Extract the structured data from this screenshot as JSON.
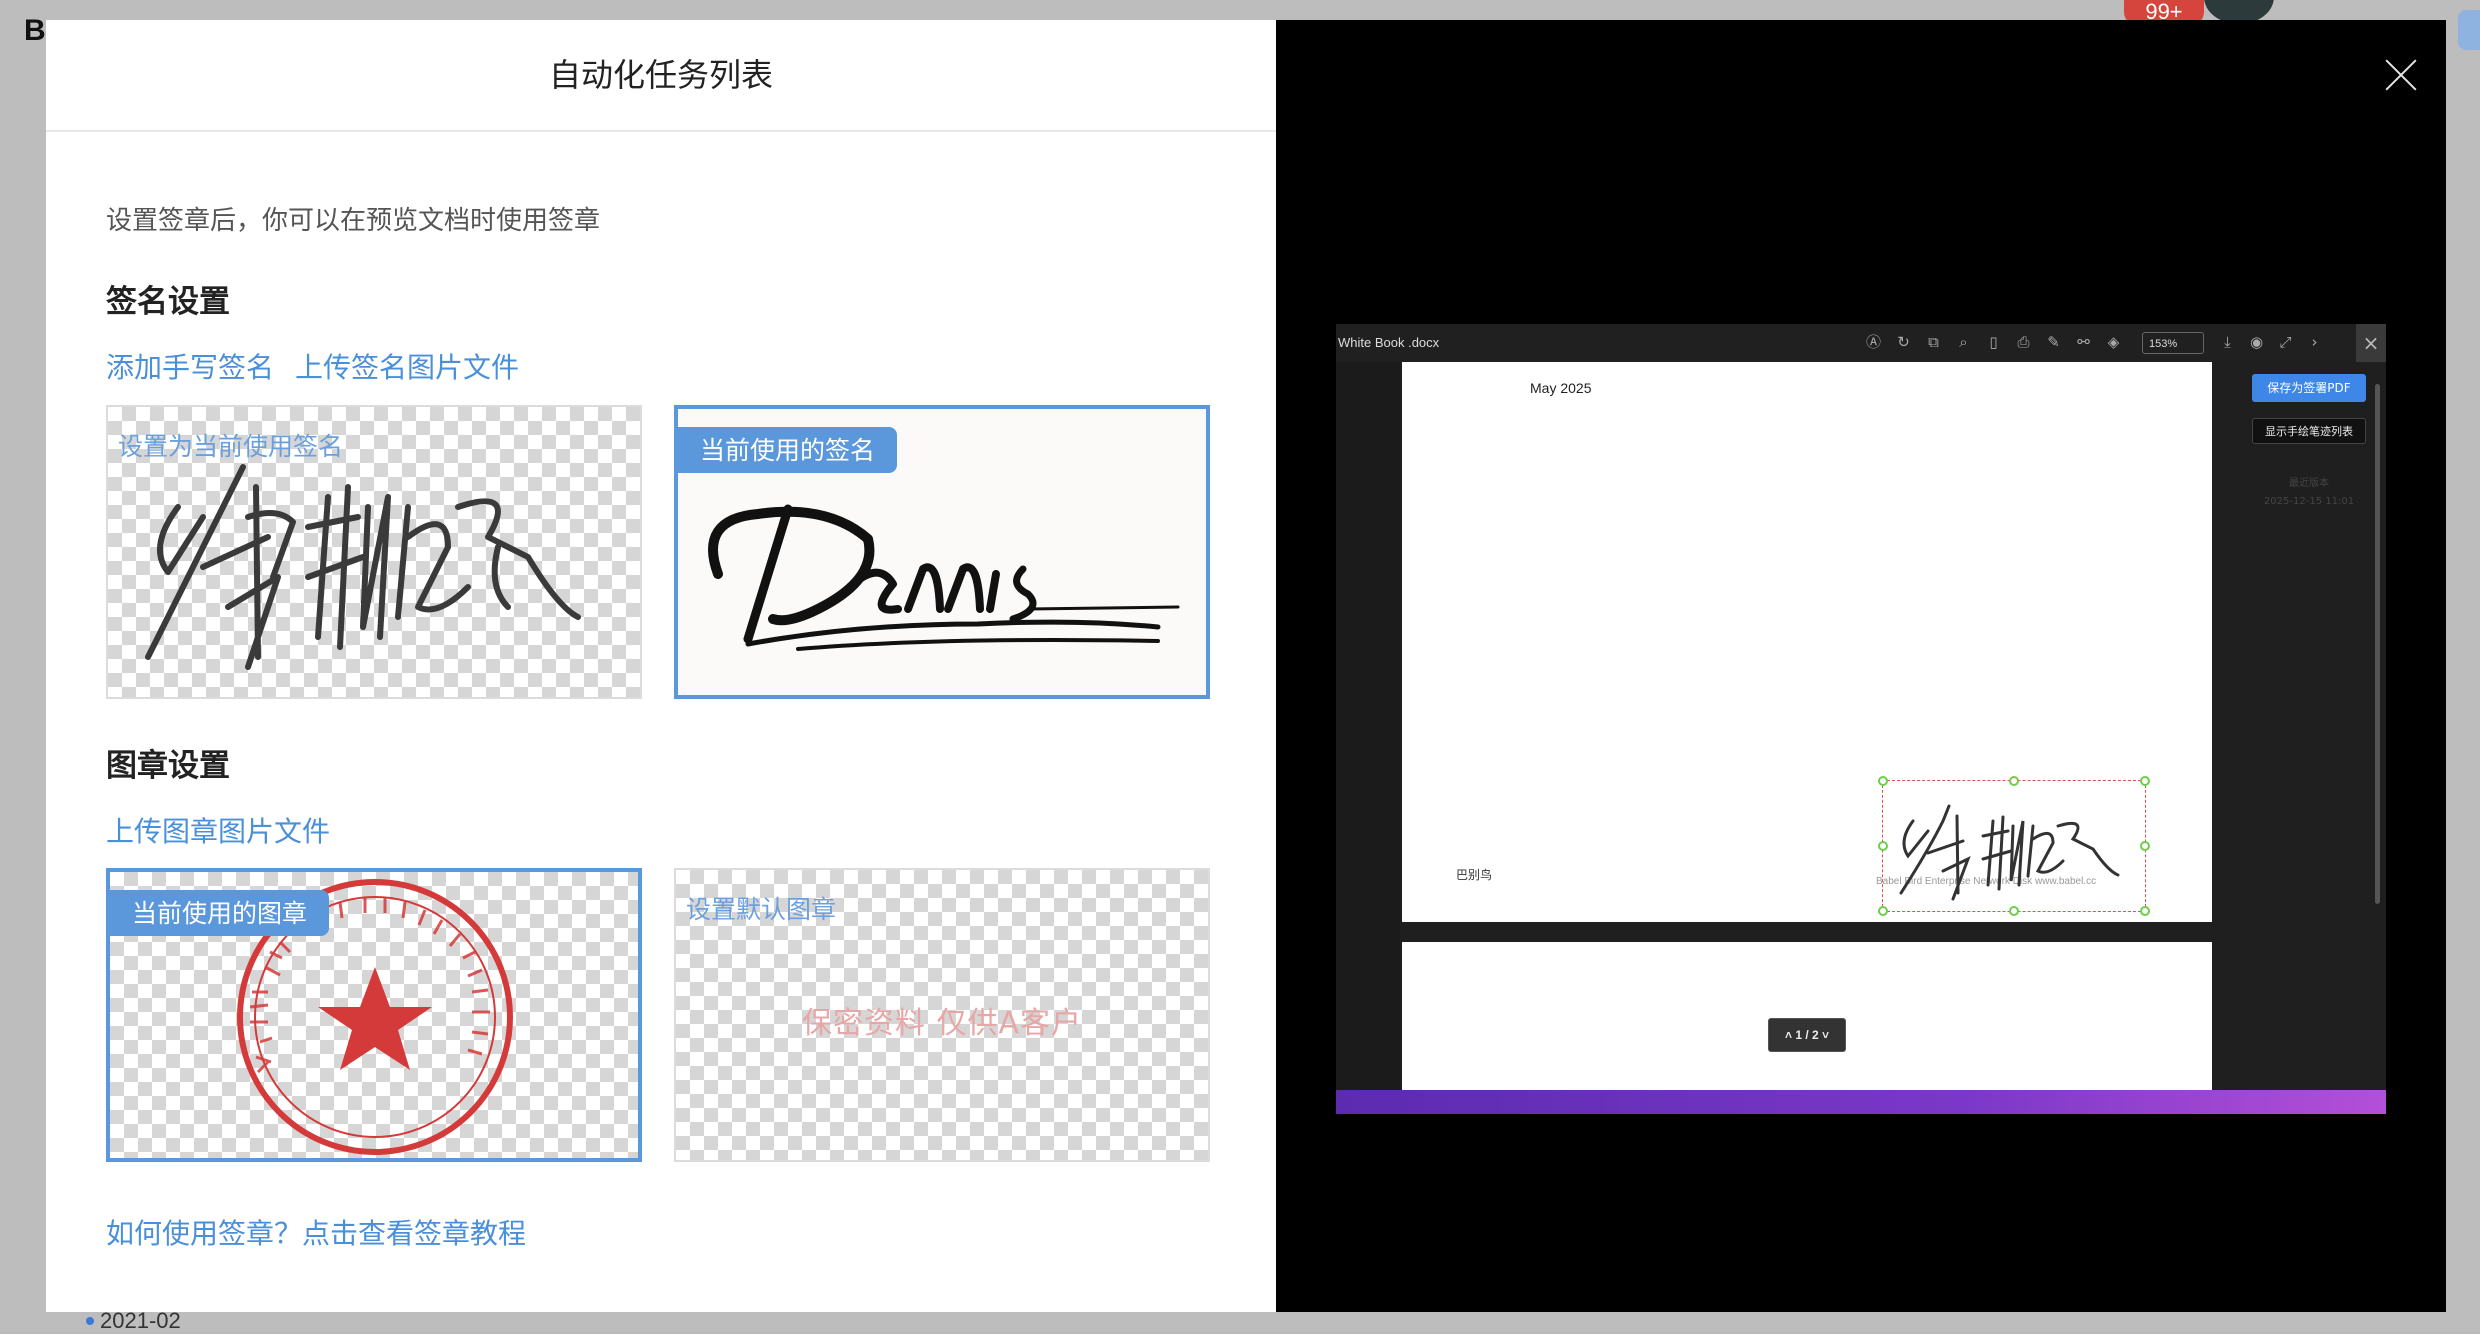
{
  "background": {
    "logo": "B",
    "badge": "99+",
    "date_item": "2021-02"
  },
  "modal": {
    "title": "自动化任务列表",
    "intro": "设置签章后，你可以在预览文档时使用签章",
    "signature_section": {
      "title": "签名设置",
      "add_handwritten": "添加手写签名",
      "upload_image": "上传签名图片文件",
      "cards": [
        {
          "hint": "设置为当前使用签名",
          "active": false
        },
        {
          "tag": "当前使用的签名",
          "active": true
        }
      ]
    },
    "seal_section": {
      "title": "图章设置",
      "upload_image": "上传图章图片文件",
      "cards": [
        {
          "tag": "当前使用的图章",
          "active": true
        },
        {
          "hint": "设置默认图章",
          "watermark": "保密资料 仅供A客户",
          "active": false
        }
      ]
    },
    "help_link": "如何使用签章？点击查看签章教程"
  },
  "preview": {
    "file_name": "White Book .docx",
    "zoom": "153%",
    "page_date": "May 2025",
    "page_logo": "巴别鸟",
    "page_footer": "Babel Bird Enterprise Network Disk www.babel.cc",
    "save_button": "保存为签署PDF",
    "show_button": "显示手绘笔迹列表",
    "side_title": "最近版本",
    "side_time": "2025-12-15 11:01",
    "pager": "1 / 2",
    "colors": {
      "accent": "#3e86e8",
      "selection": "#e05050",
      "handle": "#6ccf4a"
    }
  },
  "colors": {
    "link": "#4a8fd9",
    "active_border": "#5b97db",
    "seal_red": "#d53a3a"
  }
}
